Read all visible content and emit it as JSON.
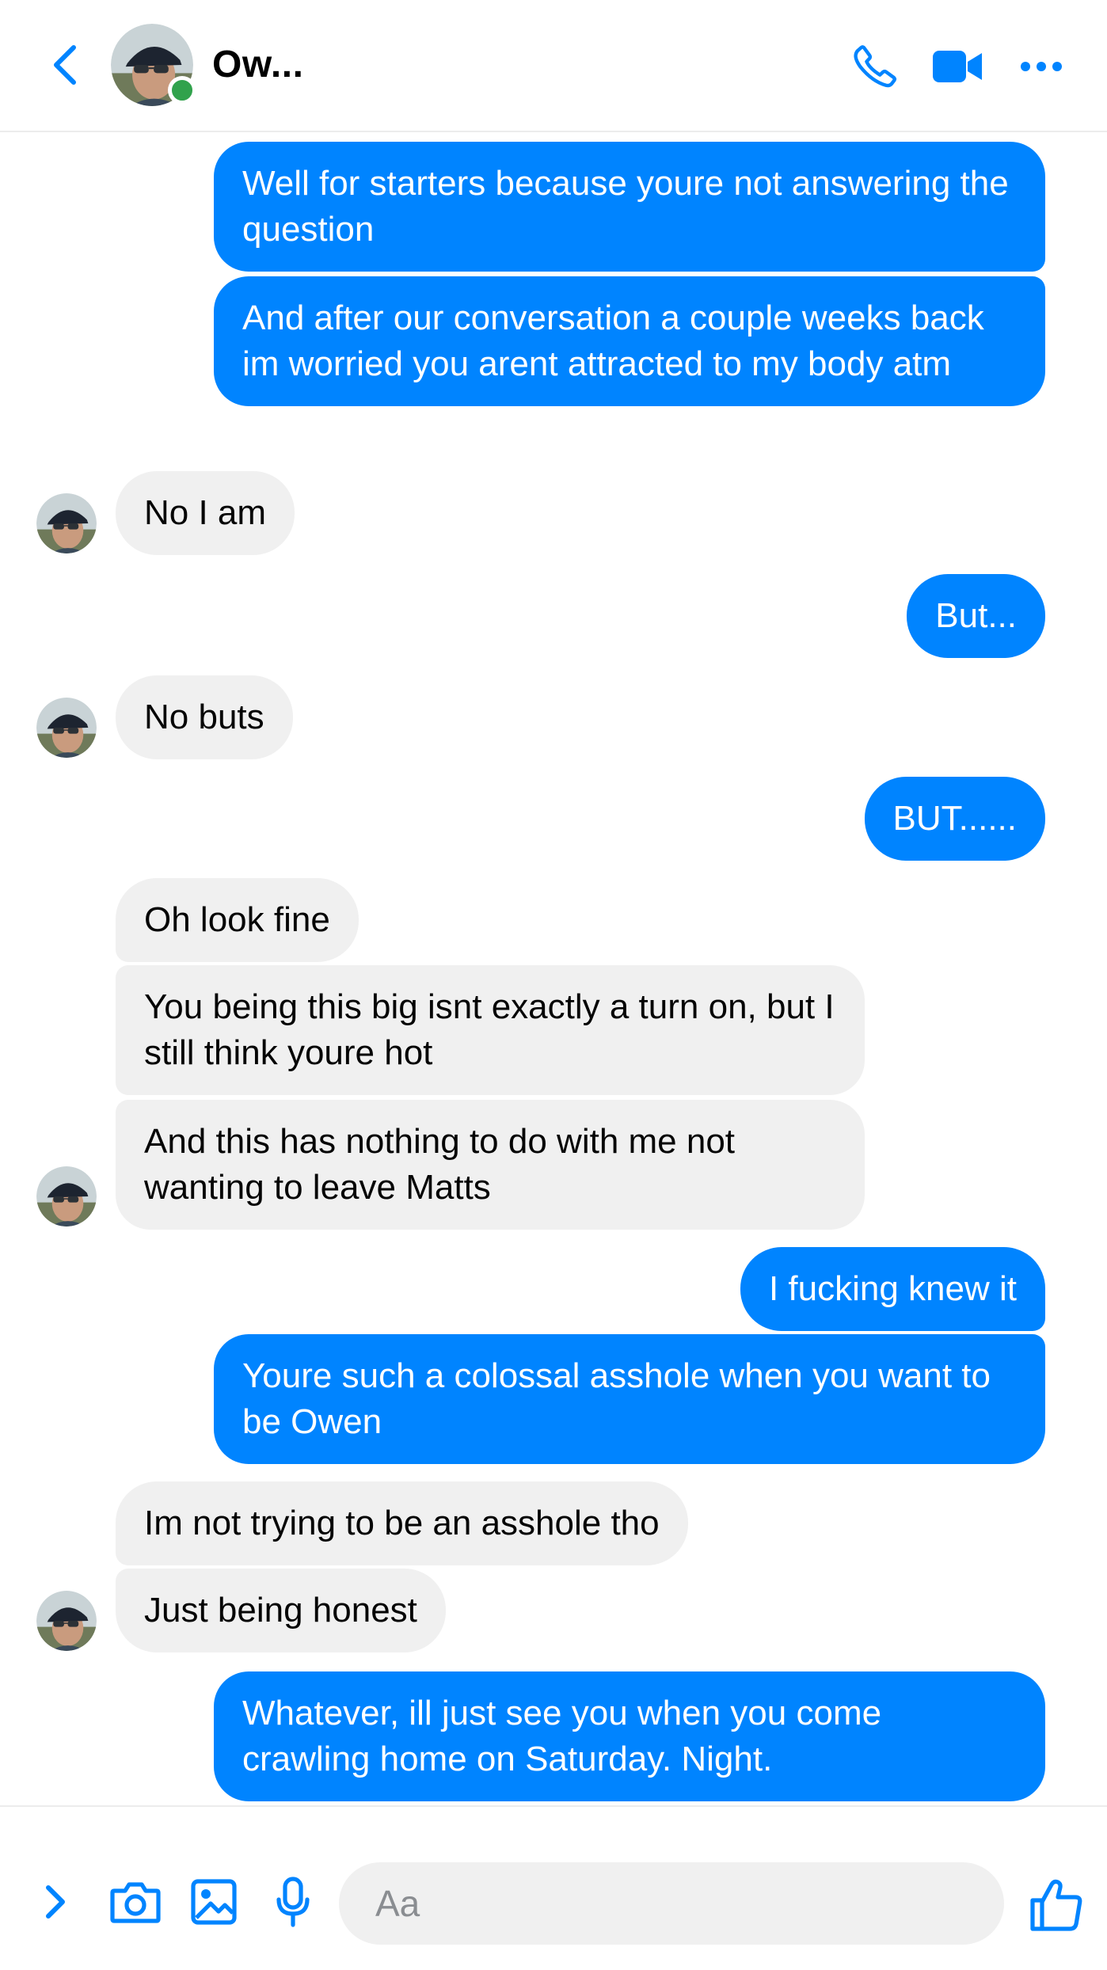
{
  "header": {
    "contact_name": "Ow...",
    "online": true,
    "accent_color": "#0084ff",
    "icons": [
      "back-chevron-icon",
      "phone-icon",
      "video-camera-icon",
      "more-dots-icon"
    ]
  },
  "messages": [
    {
      "sender": "me",
      "text": "Well for starters because youre not answering the question"
    },
    {
      "sender": "me",
      "text": "And after our conversation a couple weeks back im worried you arent attracted to my body atm"
    },
    {
      "sender": "them",
      "text": "No I am"
    },
    {
      "sender": "me",
      "text": "But..."
    },
    {
      "sender": "them",
      "text": "No buts"
    },
    {
      "sender": "me",
      "text": "BUT......"
    },
    {
      "sender": "them",
      "text": "Oh look fine"
    },
    {
      "sender": "them",
      "text": "You being this big isnt exactly a turn on, but I still think youre hot"
    },
    {
      "sender": "them",
      "text": "And this has nothing to do with me not wanting to leave Matts"
    },
    {
      "sender": "me",
      "text": "I fucking knew it"
    },
    {
      "sender": "me",
      "text": "Youre such a colossal asshole when you want to be Owen"
    },
    {
      "sender": "them",
      "text": "Im not trying to be an asshole tho"
    },
    {
      "sender": "them",
      "text": "Just being honest"
    },
    {
      "sender": "me",
      "text": "Whatever, ill just see you when you come crawling home on Saturday. Night."
    }
  ],
  "composer": {
    "placeholder": "Aa",
    "icons": [
      "chevron-right-icon",
      "camera-icon",
      "gallery-icon",
      "microphone-icon",
      "thumbs-up-icon"
    ]
  },
  "colors": {
    "outgoing_bubble": "#0084ff",
    "incoming_bubble": "#f0f0f0",
    "online_dot": "#31a24c"
  }
}
